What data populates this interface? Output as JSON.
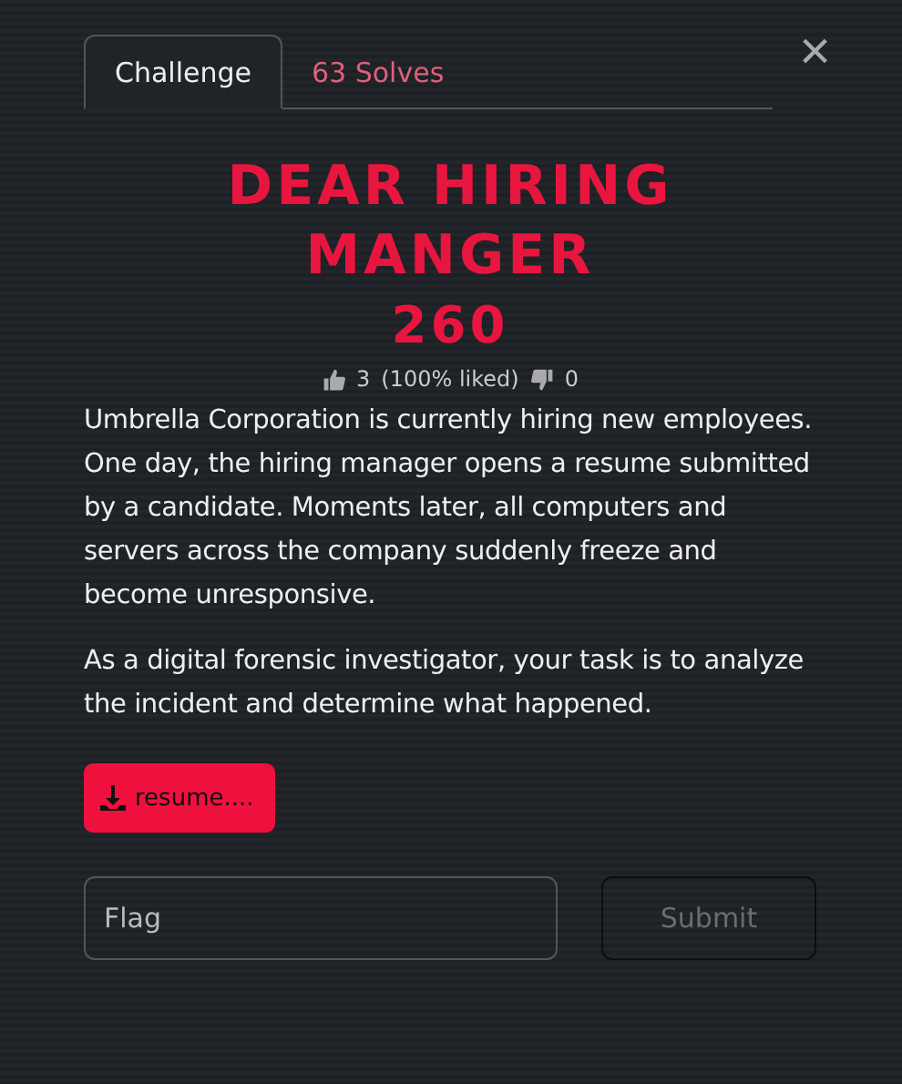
{
  "tabs": [
    {
      "label": "Challenge",
      "selected": true
    },
    {
      "label": "63 Solves",
      "selected": false
    }
  ],
  "close": "×",
  "title": "DEAR HIRING MANGER",
  "points": "260",
  "likes": {
    "up": "3",
    "percent": "(100% liked)",
    "down": "0"
  },
  "description": [
    "Umbrella Corporation is currently hiring new employees. One day, the hiring manager opens a resume submitted by a candidate. Moments later, all computers and servers across the company suddenly freeze and become unresponsive.",
    "As a digital forensic investigator, your task is to analyze the incident and determine what happened."
  ],
  "file": "resume....",
  "flag": {
    "placeholder": "Flag"
  },
  "submit": "Submit"
}
